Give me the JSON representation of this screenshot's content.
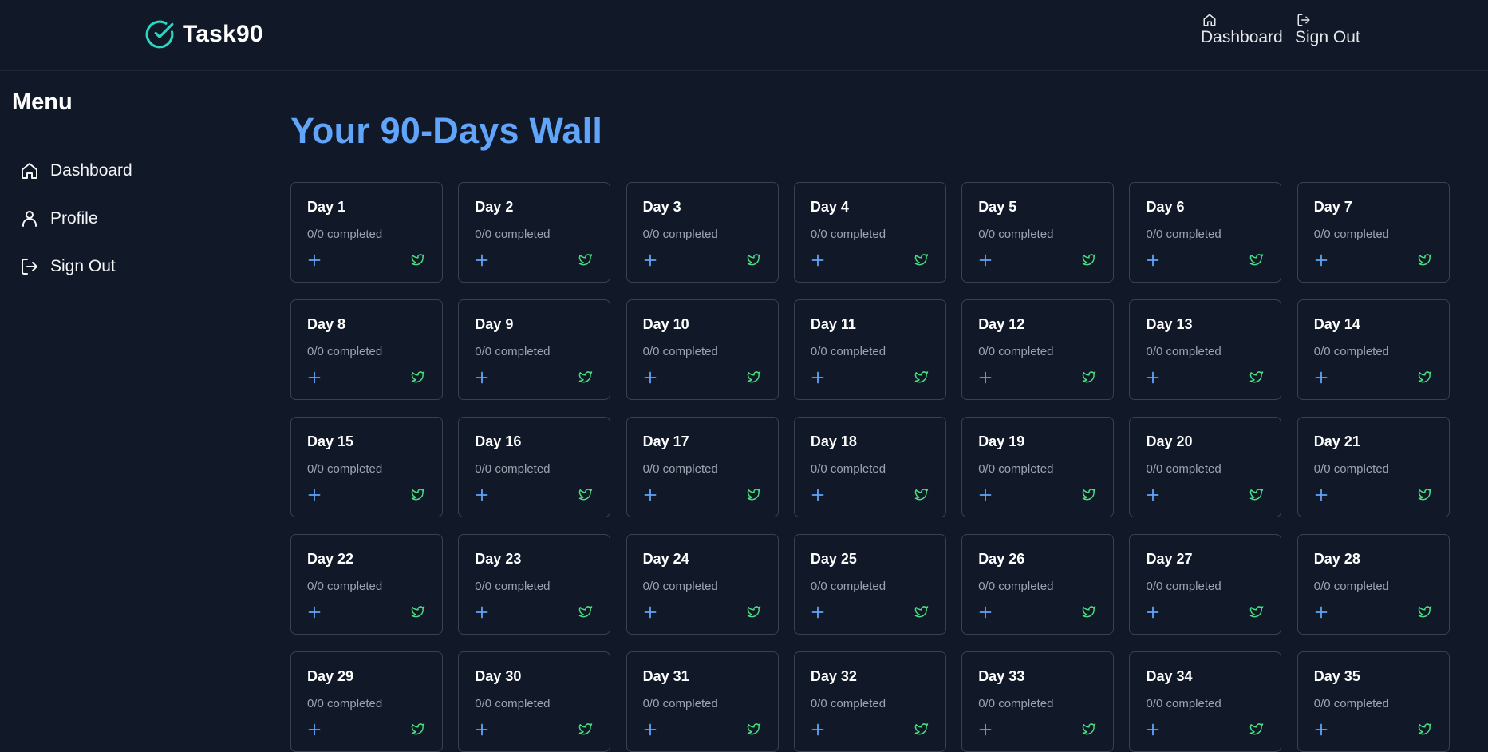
{
  "header": {
    "brand": "Task90",
    "nav": [
      {
        "label": "Dashboard",
        "icon": "home-icon"
      },
      {
        "label": "Sign Out",
        "icon": "sign-out-icon"
      }
    ]
  },
  "sidebar": {
    "title": "Menu",
    "items": [
      {
        "label": "Dashboard",
        "icon": "home-icon"
      },
      {
        "label": "Profile",
        "icon": "user-icon"
      },
      {
        "label": "Sign Out",
        "icon": "sign-out-icon"
      }
    ]
  },
  "main": {
    "title": "Your 90-Days Wall",
    "days": [
      {
        "title": "Day 1",
        "status": "0/0 completed"
      },
      {
        "title": "Day 2",
        "status": "0/0 completed"
      },
      {
        "title": "Day 3",
        "status": "0/0 completed"
      },
      {
        "title": "Day 4",
        "status": "0/0 completed"
      },
      {
        "title": "Day 5",
        "status": "0/0 completed"
      },
      {
        "title": "Day 6",
        "status": "0/0 completed"
      },
      {
        "title": "Day 7",
        "status": "0/0 completed"
      },
      {
        "title": "Day 8",
        "status": "0/0 completed"
      },
      {
        "title": "Day 9",
        "status": "0/0 completed"
      },
      {
        "title": "Day 10",
        "status": "0/0 completed"
      },
      {
        "title": "Day 11",
        "status": "0/0 completed"
      },
      {
        "title": "Day 12",
        "status": "0/0 completed"
      },
      {
        "title": "Day 13",
        "status": "0/0 completed"
      },
      {
        "title": "Day 14",
        "status": "0/0 completed"
      },
      {
        "title": "Day 15",
        "status": "0/0 completed"
      },
      {
        "title": "Day 16",
        "status": "0/0 completed"
      },
      {
        "title": "Day 17",
        "status": "0/0 completed"
      },
      {
        "title": "Day 18",
        "status": "0/0 completed"
      },
      {
        "title": "Day 19",
        "status": "0/0 completed"
      },
      {
        "title": "Day 20",
        "status": "0/0 completed"
      },
      {
        "title": "Day 21",
        "status": "0/0 completed"
      },
      {
        "title": "Day 22",
        "status": "0/0 completed"
      },
      {
        "title": "Day 23",
        "status": "0/0 completed"
      },
      {
        "title": "Day 24",
        "status": "0/0 completed"
      },
      {
        "title": "Day 25",
        "status": "0/0 completed"
      },
      {
        "title": "Day 26",
        "status": "0/0 completed"
      },
      {
        "title": "Day 27",
        "status": "0/0 completed"
      },
      {
        "title": "Day 28",
        "status": "0/0 completed"
      },
      {
        "title": "Day 29",
        "status": "0/0 completed"
      },
      {
        "title": "Day 30",
        "status": "0/0 completed"
      },
      {
        "title": "Day 31",
        "status": "0/0 completed"
      },
      {
        "title": "Day 32",
        "status": "0/0 completed"
      },
      {
        "title": "Day 33",
        "status": "0/0 completed"
      },
      {
        "title": "Day 34",
        "status": "0/0 completed"
      },
      {
        "title": "Day 35",
        "status": "0/0 completed"
      }
    ],
    "card_icons": {
      "add": "plus-icon",
      "share": "twitter-icon"
    }
  },
  "colors": {
    "background": "#111827",
    "title_accent": "#60a5fa",
    "brand_check": "#2dd4bf",
    "add_icon": "#60a5fa",
    "share_icon": "#4ade80",
    "card_border": "#374151"
  }
}
